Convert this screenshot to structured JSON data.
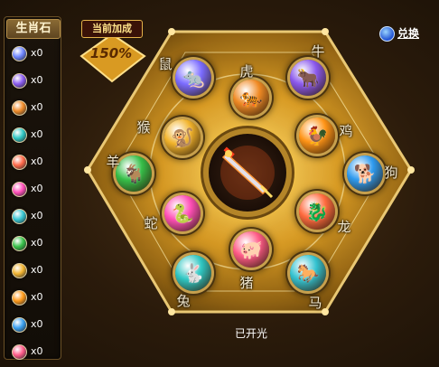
{
  "sidebar": {
    "title": "生肖石",
    "stones": [
      {
        "name": "rat",
        "color": "#6f86ff",
        "count": "x0"
      },
      {
        "name": "ox",
        "color": "#8b5cf0",
        "count": "x0"
      },
      {
        "name": "tiger",
        "color": "#f08c2a",
        "count": "x0"
      },
      {
        "name": "rabbit",
        "color": "#2fc7c4",
        "count": "x0"
      },
      {
        "name": "dragon",
        "color": "#ff6a4a",
        "count": "x0"
      },
      {
        "name": "snake",
        "color": "#ff4fb9",
        "count": "x0"
      },
      {
        "name": "horse",
        "color": "#37c6d2",
        "count": "x0"
      },
      {
        "name": "goat",
        "color": "#39c24a",
        "count": "x0"
      },
      {
        "name": "monkey",
        "color": "#f2b431",
        "count": "x0"
      },
      {
        "name": "rooster",
        "color": "#ff9a1a",
        "count": "x0"
      },
      {
        "name": "dog",
        "color": "#3aa0f0",
        "count": "x0"
      },
      {
        "name": "pig",
        "color": "#ff5c8a",
        "count": "x0"
      }
    ]
  },
  "bonus": {
    "label": "当前加成",
    "value": "150%"
  },
  "exchange": {
    "label": "兑换"
  },
  "zodiac": [
    {
      "key": "rat",
      "label": "鼠",
      "color": "#7b6cff",
      "glyph": "🐀"
    },
    {
      "key": "tiger",
      "label": "虎",
      "color": "#f08a24",
      "glyph": "🐅"
    },
    {
      "key": "ox",
      "label": "牛",
      "color": "#8a58ec",
      "glyph": "🐂"
    },
    {
      "key": "monkey",
      "label": "猴",
      "color": "#f2b32b",
      "glyph": "🐒"
    },
    {
      "key": "rooster",
      "label": "鸡",
      "color": "#ff9416",
      "glyph": "🐓"
    },
    {
      "key": "goat",
      "label": "羊",
      "color": "#36be48",
      "glyph": "🐐"
    },
    {
      "key": "dog",
      "label": "狗",
      "color": "#2e9aee",
      "glyph": "🐕"
    },
    {
      "key": "snake",
      "label": "蛇",
      "color": "#ff4fb6",
      "glyph": "🐍"
    },
    {
      "key": "dragon",
      "label": "龙",
      "color": "#ff6a3e",
      "glyph": "🐉"
    },
    {
      "key": "pig",
      "label": "猪",
      "color": "#ff5a86",
      "glyph": "🐖"
    },
    {
      "key": "rabbit",
      "label": "兔",
      "color": "#2fc6c2",
      "glyph": "🐇"
    },
    {
      "key": "horse",
      "label": "马",
      "color": "#33c2d0",
      "glyph": "🐎"
    }
  ],
  "status": "已开光"
}
